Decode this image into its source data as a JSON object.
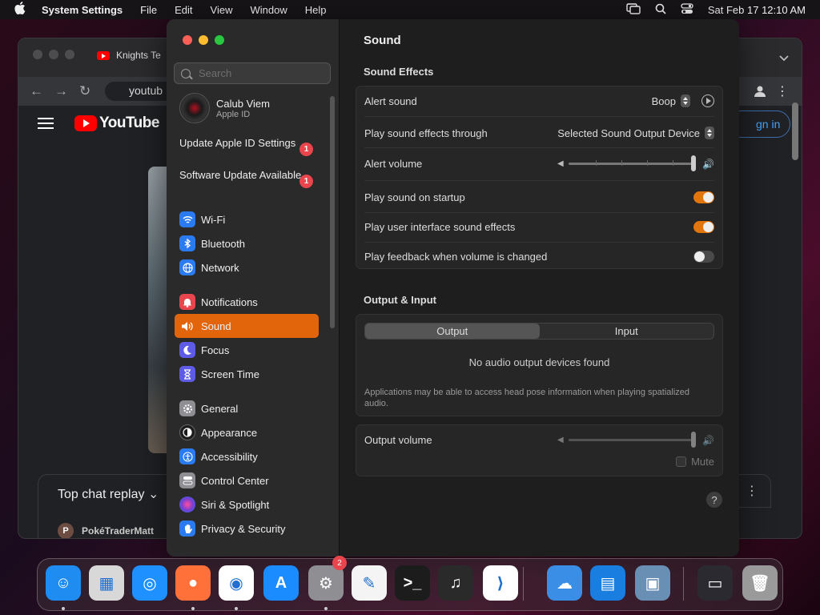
{
  "menubar": {
    "app_name": "System Settings",
    "menus": [
      "File",
      "Edit",
      "View",
      "Window",
      "Help"
    ],
    "clock": "Sat Feb 17  12:10 AM"
  },
  "browser": {
    "tab_title": "Knights Te",
    "url_text": "youtub",
    "logo_text": "YouTube",
    "signin_text": "gn in",
    "chat_title": "Top chat replay",
    "chat_avatar_letter": "P",
    "chat_user": "PokéTraderMatt"
  },
  "sidebar": {
    "search_placeholder": "Search",
    "profile_name": "Calub Viem",
    "profile_sub": "Apple ID",
    "notices": [
      {
        "label": "Update Apple ID Settings",
        "badge": "1"
      },
      {
        "label": "Software Update Available",
        "badge": "1"
      }
    ],
    "items": [
      {
        "label": "Wi-Fi",
        "icon": "wifi-icon",
        "color": "#2b7bf0"
      },
      {
        "label": "Bluetooth",
        "icon": "bluetooth-icon",
        "color": "#2b7bf0"
      },
      {
        "label": "Network",
        "icon": "globe-icon",
        "color": "#2b7bf0"
      },
      {
        "label": "Notifications",
        "icon": "bell-icon",
        "color": "#e8454d"
      },
      {
        "label": "Sound",
        "icon": "speaker-icon",
        "color": "#e8454d"
      },
      {
        "label": "Focus",
        "icon": "moon-icon",
        "color": "#5e5ce6"
      },
      {
        "label": "Screen Time",
        "icon": "hourglass-icon",
        "color": "#5e5ce6"
      },
      {
        "label": "General",
        "icon": "gear-icon",
        "color": "#8e8e93"
      },
      {
        "label": "Appearance",
        "icon": "appearance-icon",
        "color": "#1c1c1e"
      },
      {
        "label": "Accessibility",
        "icon": "accessibility-icon",
        "color": "#2b7bf0"
      },
      {
        "label": "Control Center",
        "icon": "control-center-icon",
        "color": "#8e8e93"
      },
      {
        "label": "Siri & Spotlight",
        "icon": "siri-icon",
        "color": "#7a3fd0"
      },
      {
        "label": "Privacy & Security",
        "icon": "hand-icon",
        "color": "#2b7bf0"
      }
    ],
    "active_item": "Sound",
    "accent_color": "#e2650c"
  },
  "content": {
    "title": "Sound",
    "sound_effects": {
      "heading": "Sound Effects",
      "alert_sound_label": "Alert sound",
      "alert_sound_value": "Boop",
      "play_through_label": "Play sound effects through",
      "play_through_value": "Selected Sound Output Device",
      "alert_volume_label": "Alert volume",
      "alert_volume_level": 1.0,
      "startup_label": "Play sound on startup",
      "startup_on": true,
      "ui_effects_label": "Play user interface sound effects",
      "ui_effects_on": true,
      "feedback_label": "Play feedback when volume is changed",
      "feedback_on": false
    },
    "output_input": {
      "heading": "Output & Input",
      "tab_output": "Output",
      "tab_input": "Input",
      "selected_tab": "Output",
      "empty_message": "No audio output devices found",
      "note": "Applications may be able to access head pose information when playing spatialized audio.",
      "output_volume_label": "Output volume",
      "output_volume_level": 1.0,
      "mute_label": "Mute"
    },
    "help_label": "?"
  },
  "dock": {
    "software_update_badge": "2",
    "apps": [
      {
        "name": "finder-icon",
        "color": "#1e8cf0"
      },
      {
        "name": "launchpad-icon",
        "color": "#d8d8d8"
      },
      {
        "name": "safari-icon",
        "color": "#1e90ff"
      },
      {
        "name": "firefox-icon",
        "color": "#ff7139"
      },
      {
        "name": "chrome-icon",
        "color": "#ffffff"
      },
      {
        "name": "app-store-icon",
        "color": "#1a8cff"
      },
      {
        "name": "system-settings-icon",
        "color": "#8e8e93"
      },
      {
        "name": "textedit-icon",
        "color": "#f4f4f4"
      },
      {
        "name": "terminal-icon",
        "color": "#1c1c1c"
      },
      {
        "name": "garageband-icon",
        "color": "#2a2a2a"
      },
      {
        "name": "vscode-icon",
        "color": "#ffffff"
      },
      {
        "name": "weather-icon",
        "color": "#3a8ee6"
      },
      {
        "name": "keynote-icon",
        "color": "#1a7ee0"
      },
      {
        "name": "preview-icon",
        "color": "#6a8fb5"
      },
      {
        "name": "minimized-window-icon",
        "color": "#2a2a30"
      },
      {
        "name": "trash-icon",
        "color": "#9a9a9a"
      }
    ]
  }
}
